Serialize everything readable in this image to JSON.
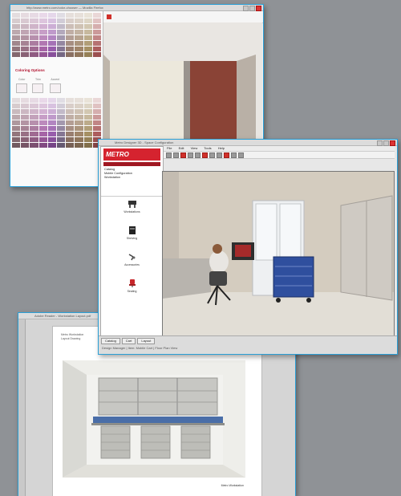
{
  "window1": {
    "title": "http://www.metro.com/color-chooser — Mozilla Firefox",
    "section_title": "Coloring Options",
    "labels": [
      "Color",
      "Trim",
      "Accent"
    ]
  },
  "window2": {
    "title": "Metro Designer 3D - Space Configuration",
    "menu": [
      "File",
      "Edit",
      "View",
      "Tools",
      "Help"
    ],
    "logo": "METRO",
    "side_lines": [
      "Catalog",
      "Mobile Configuration",
      "Workstation"
    ],
    "categories": [
      "Workstations",
      "Shelving",
      "Accessories",
      "Seating"
    ],
    "tabs": [
      "Catalog",
      "Cart",
      "Layout"
    ],
    "status_text": "Design Manager  |  Item: Mobile Cart  |  Floor Plan View"
  },
  "window3": {
    "title": "Adobe Reader - Workstation Layout.pdf",
    "doc_header": [
      "Metro Workstation",
      "Layout Drawing"
    ],
    "doc_footer": "Metro Workstation"
  },
  "colors": {
    "background": "#8f9296",
    "window_border": "#2a9fd6",
    "brand_red": "#d5232f",
    "cart_blue": "#2f4f9e"
  }
}
